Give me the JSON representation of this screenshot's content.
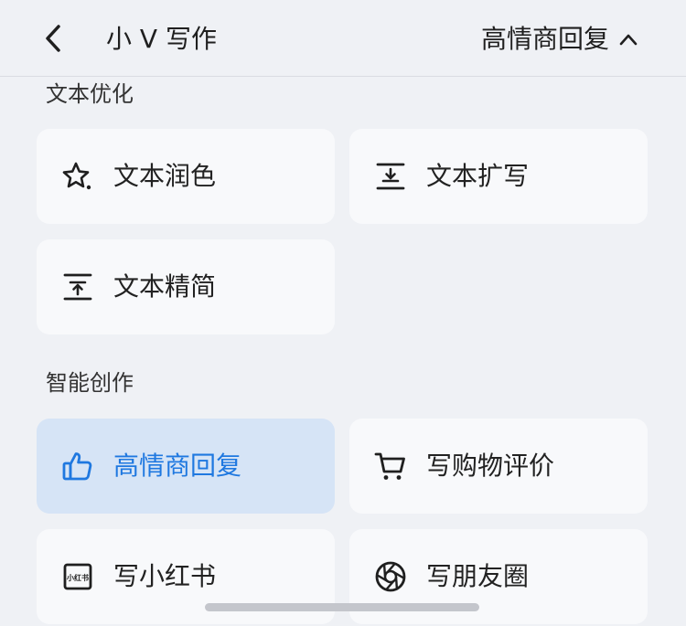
{
  "header": {
    "title": "小 V 写作",
    "mode_label": "高情商回复"
  },
  "sections": [
    {
      "title": "文本优化",
      "items": [
        {
          "label": "文本润色",
          "icon": "star-sparkle-icon"
        },
        {
          "label": "文本扩写",
          "icon": "text-expand-icon"
        },
        {
          "label": "文本精简",
          "icon": "text-condense-icon"
        }
      ]
    },
    {
      "title": "智能创作",
      "items": [
        {
          "label": "高情商回复",
          "icon": "thumbs-up-icon",
          "selected": true
        },
        {
          "label": "写购物评价",
          "icon": "shopping-cart-icon"
        },
        {
          "label": "写小红书",
          "icon": "xiaohongshu-icon",
          "icon_text": "小红书"
        },
        {
          "label": "写朋友圈",
          "icon": "camera-aperture-icon"
        }
      ]
    }
  ],
  "colors": {
    "background": "#eff1f5",
    "card": "#f8f9fb",
    "selected_card": "#d6e4f6",
    "accent": "#1f78e0",
    "text": "#222222"
  }
}
